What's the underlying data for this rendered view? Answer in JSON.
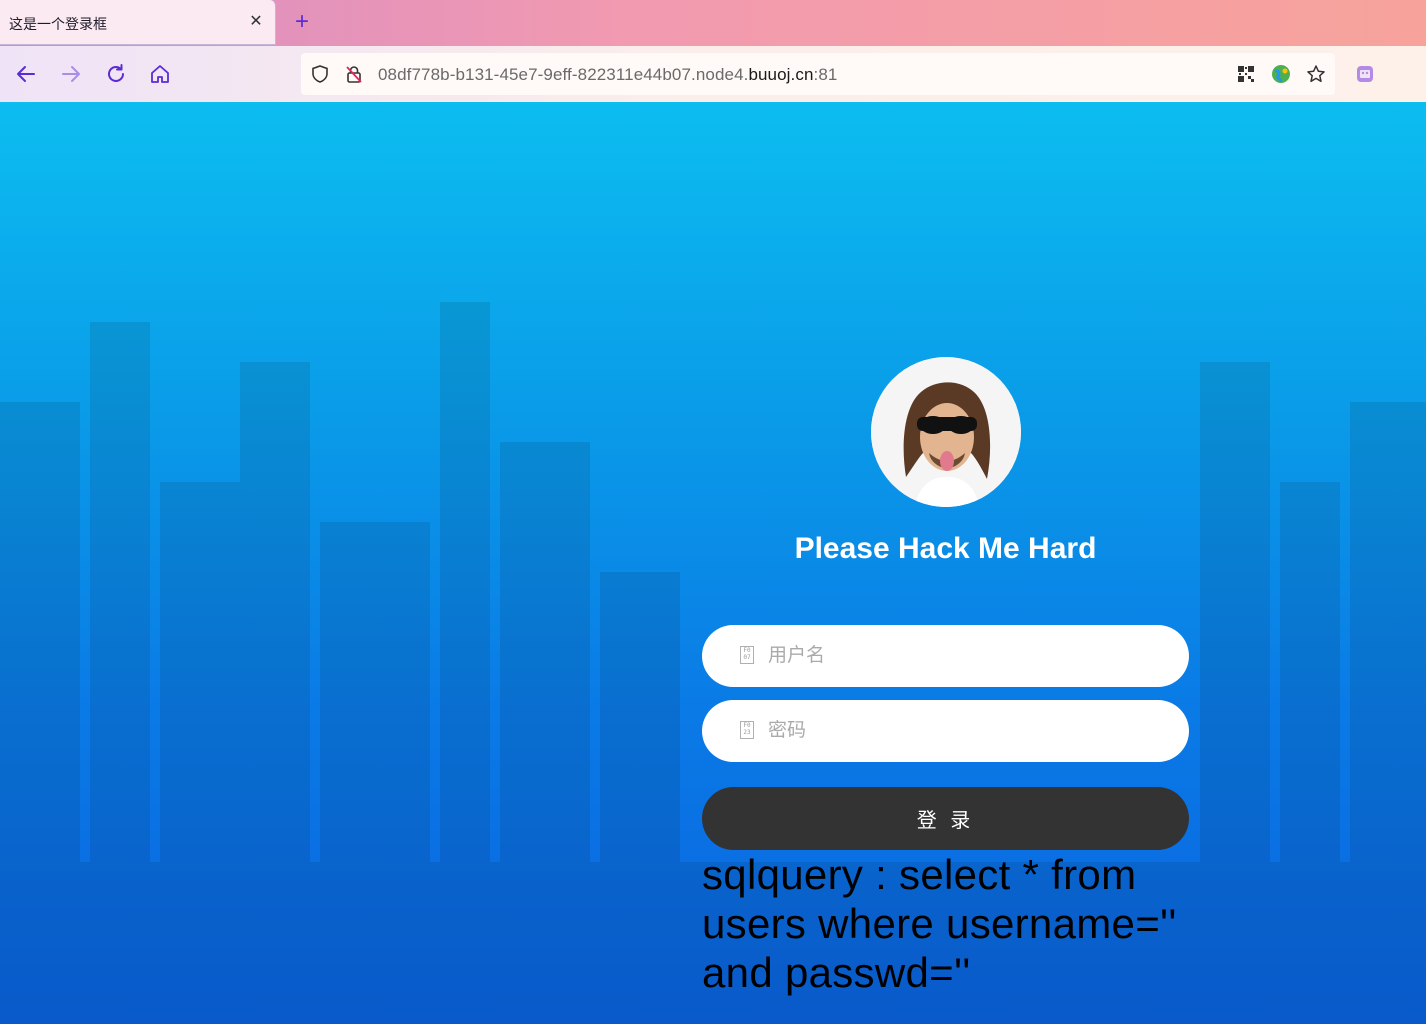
{
  "browser": {
    "tab_title": "这是一个登录框",
    "tab_close": "✕",
    "new_tab": "+",
    "url_prefix": "08df778b-b131-45e7-9eff-822311e44b07.node4.",
    "url_domain": "buuoj.cn",
    "url_suffix": ":81"
  },
  "page": {
    "title": "Please Hack Me Hard",
    "username_placeholder": "用户名",
    "password_placeholder": "密码",
    "login_label": "登 录",
    "sql_query": "sqlquery : select * from users where username='' and passwd=''"
  },
  "colors": {
    "background_top": "#0cbdf0",
    "background_bottom": "#0a63df",
    "button": "#333333",
    "accent": "#5b2bd6"
  },
  "icons": [
    "back-icon",
    "forward-icon",
    "reload-icon",
    "home-icon",
    "shield-icon",
    "insecure-lock-icon",
    "qr-code-icon",
    "globe-icon",
    "star-icon",
    "extension-icon"
  ]
}
